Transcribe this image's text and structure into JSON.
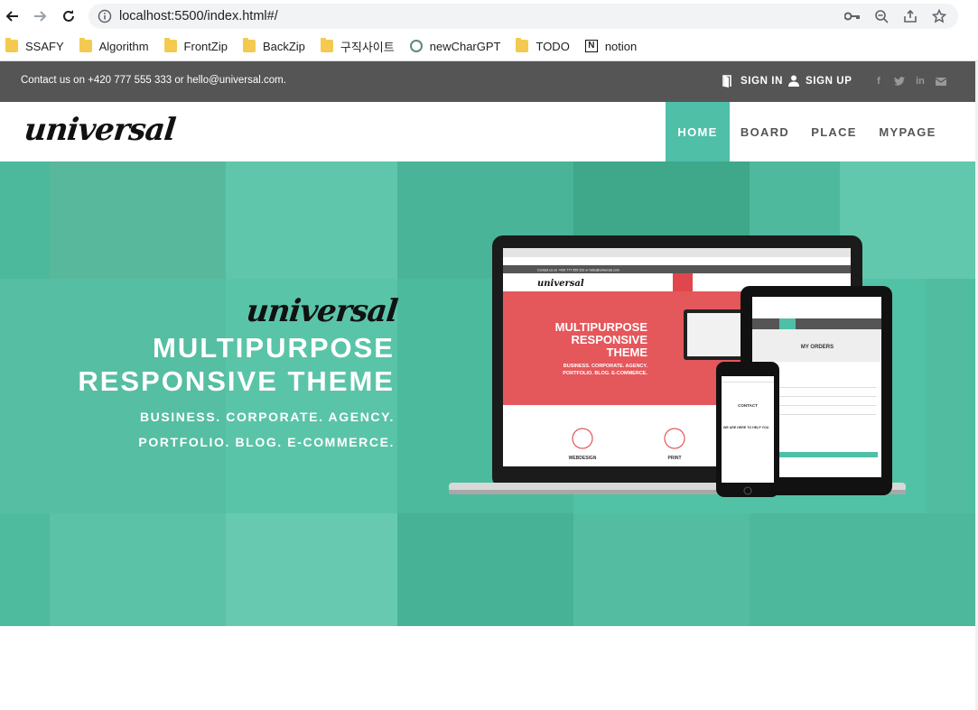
{
  "browser": {
    "url": "localhost:5500/index.html#/",
    "bookmarks": [
      {
        "label": "SSAFY",
        "icon": "folder-icon"
      },
      {
        "label": "Algorithm",
        "icon": "folder-icon"
      },
      {
        "label": "FrontZip",
        "icon": "folder-icon"
      },
      {
        "label": "BackZip",
        "icon": "folder-icon"
      },
      {
        "label": "구직사이트",
        "icon": "folder-icon"
      },
      {
        "label": "newCharGPT",
        "icon": "chatgpt-icon"
      },
      {
        "label": "TODO",
        "icon": "folder-icon"
      },
      {
        "label": "notion",
        "icon": "notion-icon"
      }
    ]
  },
  "topbar": {
    "contact": "Contact us on +420 777 555 333 or hello@universal.com.",
    "sign_in": "SIGN IN",
    "sign_up": "SIGN UP",
    "social": [
      "f",
      "t",
      "in",
      "✉"
    ]
  },
  "nav": {
    "logo": "universal",
    "items": [
      "HOME",
      "BOARD",
      "PLACE",
      "MYPAGE"
    ]
  },
  "hero": {
    "logo": "universal",
    "title_line1": "MULTIPURPOSE",
    "title_line2": "RESPONSIVE THEME",
    "subtitle_line1": "BUSINESS. CORPORATE. AGENCY.",
    "subtitle_line2": "PORTFOLIO. BLOG. E-COMMERCE.",
    "mockup": {
      "screen_title_1": "MULTIPURPOSE",
      "screen_title_2": "RESPONSIVE",
      "screen_title_3": "THEME",
      "screen_sub": "BUSINESS. CORPORATE. AGENCY.",
      "screen_sub2": "PORTFOLIO. BLOG. E-COMMERCE.",
      "feature1": "WEBDESIGN",
      "feature2": "PRINT",
      "tablet_heading": "MY ORDERS",
      "phone_heading": "CONTACT",
      "phone_sub": "WE ARE HERE TO HELP YOU"
    }
  },
  "colors": {
    "accent": "#4fbfa8",
    "topbar": "#555555",
    "hero": "#52c2a6"
  }
}
